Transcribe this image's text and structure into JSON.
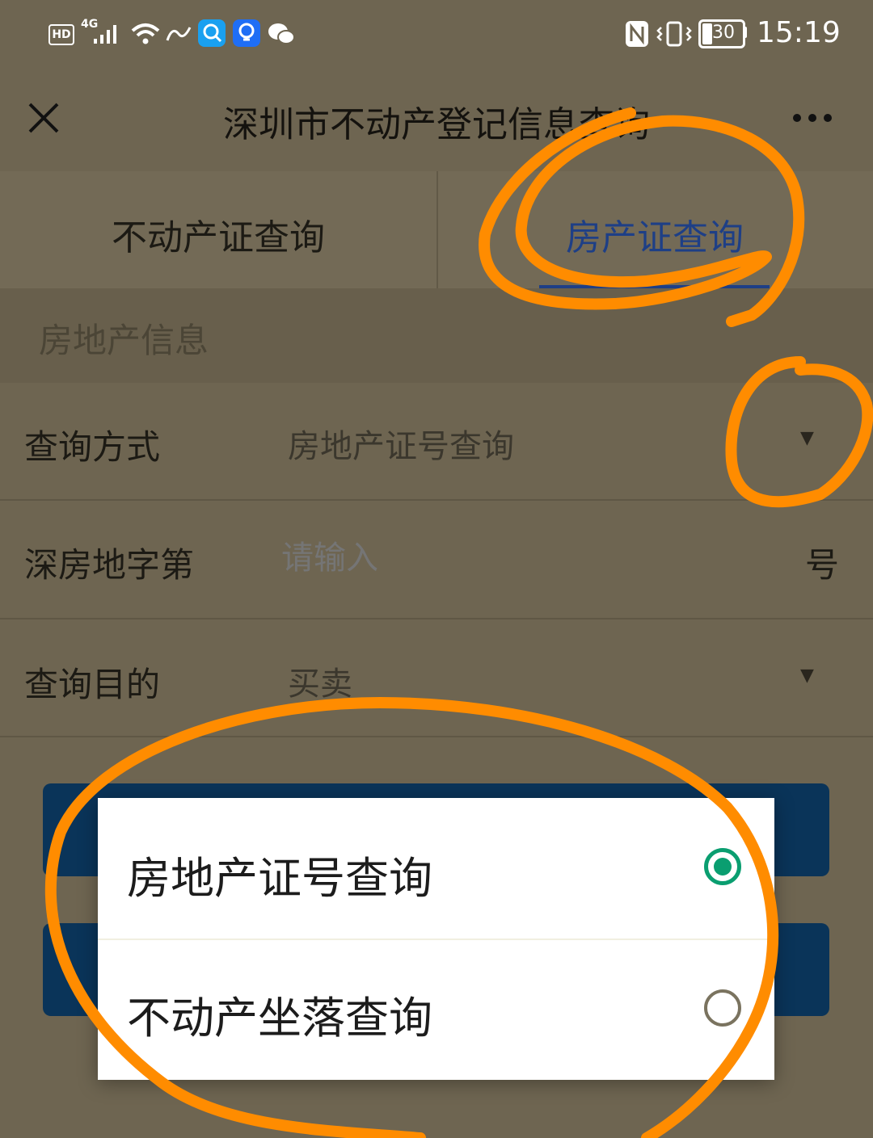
{
  "status_bar": {
    "hd": "HD",
    "network": "4G",
    "battery": "30",
    "time": "15:19"
  },
  "header": {
    "title": "深圳市不动产登记信息查询"
  },
  "tabs": [
    {
      "label": "不动产证查询",
      "active": false
    },
    {
      "label": "房产证查询",
      "active": true
    }
  ],
  "section": {
    "title": "房地产信息"
  },
  "form": {
    "query_method": {
      "label": "查询方式",
      "value": "房地产证号查询"
    },
    "cert_number": {
      "label": "深房地字第",
      "placeholder": "请输入",
      "suffix": "号"
    },
    "purpose": {
      "label": "查询目的",
      "value": "买卖"
    }
  },
  "popup": {
    "options": [
      {
        "label": "房地产证号查询",
        "selected": true
      },
      {
        "label": "不动产坐落查询",
        "selected": false
      }
    ]
  },
  "colors": {
    "accent_blue": "#1e3f86",
    "selected_green": "#0a9e70",
    "annotation_orange": "#ff8c00",
    "button_blue": "#0a3459"
  },
  "icons": [
    "close-icon",
    "more-icon",
    "dropdown-caret-icon",
    "radio-selected-icon",
    "radio-unselected-icon"
  ]
}
